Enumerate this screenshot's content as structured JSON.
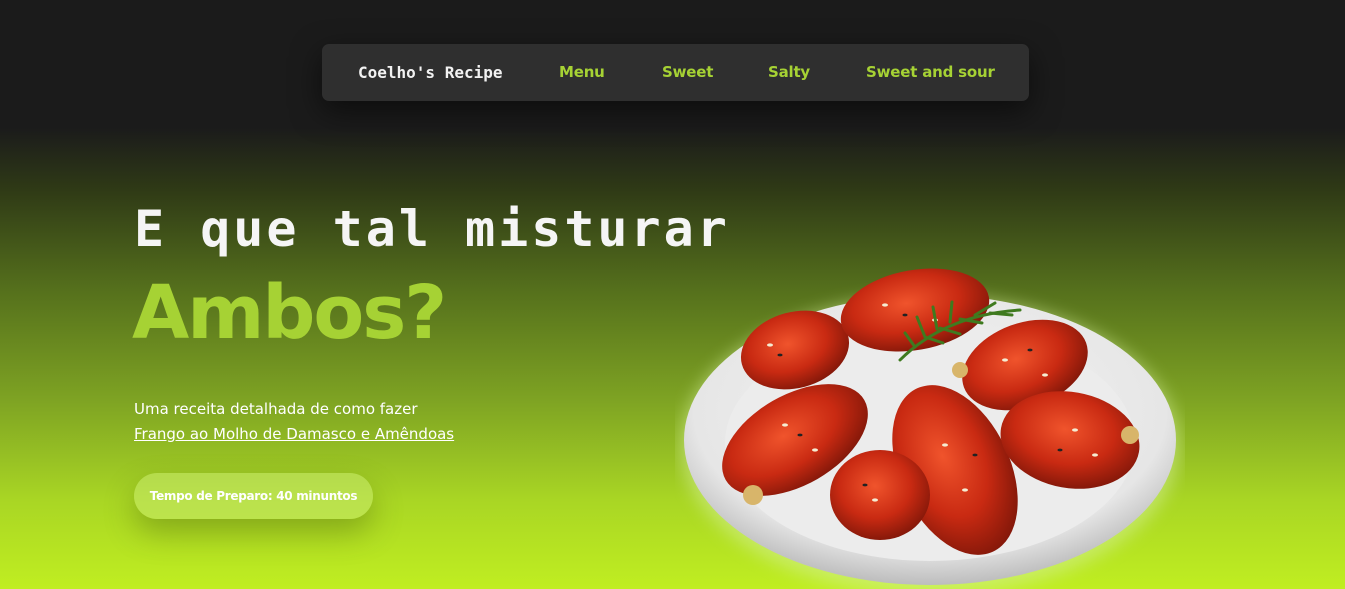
{
  "nav": {
    "brand": "Coelho's Recipe",
    "links": [
      "Menu",
      "Sweet",
      "Salty",
      "Sweet and sour"
    ]
  },
  "hero": {
    "heading_line1": "E que tal misturar",
    "heading_line2": "Ambos?",
    "description": "Uma receita detalhada de como fazer",
    "recipe_link": "Frango ao Molho de Damasco e Amêndoas",
    "prep_time": "Tempo de Preparo: 40 minuntos"
  },
  "colors": {
    "accent": "#a6d234",
    "nav_bg": "#2f2f2f",
    "page_top": "#1b1b1b",
    "page_bottom": "#c0ee21"
  },
  "image": {
    "icon": "chicken-wings-plate"
  }
}
